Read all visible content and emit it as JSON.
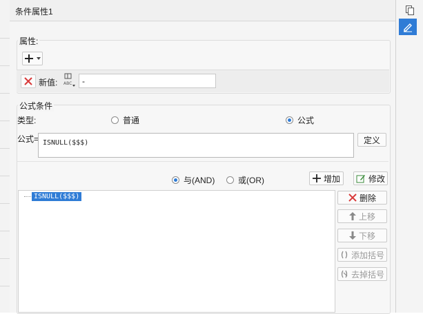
{
  "window": {
    "title": "条件属性1"
  },
  "property_group": {
    "title": "属性:",
    "new_value_label": "新值:",
    "new_value": "-"
  },
  "formula_group": {
    "title": "公式条件",
    "type_label": "类型:",
    "type_options": [
      "普通",
      "公式"
    ],
    "selected_type": "公式",
    "formula_label": "公式=",
    "formula_value": "ISNULL($$$)",
    "define_button": "定义"
  },
  "logic": {
    "and_label": "与(AND)",
    "or_label": "或(OR)",
    "selected": "与(AND)",
    "add_button": "增加",
    "modify_button": "修改"
  },
  "condition_tree": {
    "items": [
      "ISNULL($$$)"
    ]
  },
  "side_buttons": {
    "delete": "删除",
    "move_up": "上移",
    "move_down": "下移",
    "add_bracket": "添加括号",
    "remove_bracket": "去掉括号"
  },
  "colors": {
    "accent": "#2f7cd6",
    "delete_red": "#d93a3a",
    "selection": "#2f7cd6"
  },
  "icons": [
    "copy-icon",
    "edit-icon",
    "plus-icon",
    "delete-x-icon",
    "format-icon",
    "arrow-up-icon",
    "arrow-down-icon",
    "bracket-icon",
    "remove-bracket-icon",
    "modify-icon"
  ]
}
